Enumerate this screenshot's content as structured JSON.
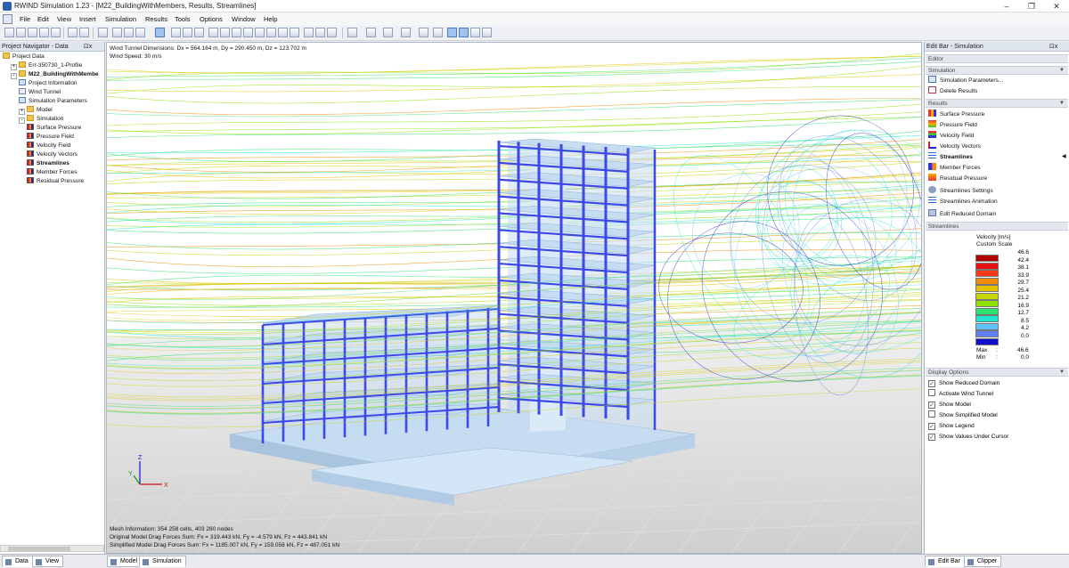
{
  "window": {
    "title": "RWIND Simulation 1.23 - [M22_BuildingWithMembers, Results, Streamlines]",
    "controls": [
      "–",
      "❐",
      "✕"
    ]
  },
  "menu": [
    "File",
    "Edit",
    "View",
    "Insert",
    "Simulation",
    "Results",
    "Tools",
    "Options",
    "Window",
    "Help"
  ],
  "navigator": {
    "title": "Project Navigator - Data",
    "pin": "⊡x",
    "items": [
      {
        "label": "Project Data",
        "icon": "folder-icon",
        "level": 0,
        "expander": "",
        "bold": false
      },
      {
        "label": "Err-350730_1-Profile",
        "icon": "folder-icon",
        "level": 1,
        "expander": "+",
        "bold": false
      },
      {
        "label": "M22_BuildingWithMembe",
        "icon": "folder-icon",
        "level": 1,
        "expander": "-",
        "bold": true
      },
      {
        "label": "Project Information",
        "icon": "document-icon",
        "level": 2,
        "expander": "",
        "bold": false
      },
      {
        "label": "Wind Tunnel",
        "icon": "wind-tunnel-icon",
        "level": 2,
        "expander": "",
        "bold": false
      },
      {
        "label": "Simulation Parameters",
        "icon": "parameters-icon",
        "level": 2,
        "expander": "",
        "bold": false
      },
      {
        "label": "Model",
        "icon": "folder-icon",
        "level": 2,
        "expander": "+",
        "bold": false
      },
      {
        "label": "Simulation",
        "icon": "folder-icon",
        "level": 2,
        "expander": "-",
        "bold": false
      },
      {
        "label": "Surface Pressure",
        "icon": "result-icon",
        "level": 3,
        "expander": "",
        "bold": false
      },
      {
        "label": "Pressure Field",
        "icon": "result-icon",
        "level": 3,
        "expander": "",
        "bold": false
      },
      {
        "label": "Velocity Field",
        "icon": "result-icon",
        "level": 3,
        "expander": "",
        "bold": false
      },
      {
        "label": "Velocity Vectors",
        "icon": "result-icon",
        "level": 3,
        "expander": "",
        "bold": false
      },
      {
        "label": "Streamlines",
        "icon": "result-icon",
        "level": 3,
        "expander": "",
        "bold": true
      },
      {
        "label": "Member Forces",
        "icon": "result-icon",
        "level": 3,
        "expander": "",
        "bold": false
      },
      {
        "label": "Residual Pressure",
        "icon": "result-icon",
        "level": 3,
        "expander": "",
        "bold": false
      }
    ],
    "tabs": [
      "Data",
      "View"
    ]
  },
  "viewport": {
    "info_top": [
      "Wind Tunnel Dimensions: Dx = 564.164 m, Dy = 290.450 m, Dz = 123.702 m",
      "Wind Speed: 30 m/s"
    ],
    "info_bottom": [
      "Mesh Information: 354 258 cells, 403 280 nodes",
      "Original Model Drag Forces Sum: Fx = 319.443 kN, Fy = -4.579 kN, Fz = 443.841 kN",
      "Simplified Model Drag Forces Sum: Fx = 1185.007 kN, Fy = 159.058 kN, Fz = 487.051 kN"
    ],
    "axes": {
      "x": "X",
      "y": "Y",
      "z": "Z"
    },
    "tabs": [
      "Model",
      "Simulation"
    ]
  },
  "editbar": {
    "title": "Edit Bar - Simulation",
    "sections": {
      "editor": "Editor",
      "simulation": "Simulation",
      "results": "Results",
      "streamlines": "Streamlines",
      "display": "Display Options"
    },
    "simulation_items": [
      "Simulation Parameters...",
      "Delete Results"
    ],
    "result_items": [
      "Surface Pressure",
      "Pressure Field",
      "Velocity Field",
      "Velocity Vectors",
      "Streamlines",
      "Member Forces",
      "Residual Pressure"
    ],
    "stream_items": [
      "Streamlines Settings",
      "Streamlines Animation",
      "Edit Reduced Domain"
    ],
    "legend": {
      "title": "Velocity [m/s]",
      "subtitle": "Custom Scale",
      "values": [
        "46.6",
        "42.4",
        "38.1",
        "33.9",
        "29.7",
        "25.4",
        "21.2",
        "16.9",
        "12.7",
        "8.5",
        "4.2",
        "0.0"
      ],
      "colors": [
        "#b00000",
        "#e61010",
        "#ff3a1a",
        "#f08a00",
        "#e6c200",
        "#c8d600",
        "#90e000",
        "#30e070",
        "#20e8d0",
        "#60c0f8",
        "#6080f0",
        "#1010c8"
      ],
      "max_label": "Max",
      "max_value": "46.6",
      "min_label": "Min",
      "min_value": "0.0",
      "sep": ":"
    },
    "display_options": [
      {
        "label": "Show Reduced Domain",
        "checked": true
      },
      {
        "label": "Activate Wind Tunnel",
        "checked": false
      },
      {
        "label": "Show Model",
        "checked": true
      },
      {
        "label": "Show Simplified Model",
        "checked": false
      },
      {
        "label": "Show Legend",
        "checked": true
      },
      {
        "label": "Show Values Under Cursor",
        "checked": true
      }
    ],
    "tabs": [
      "Edit Bar",
      "Clipper"
    ]
  },
  "colors": {
    "member": "#3d48e8",
    "slab": "#c6dcf0",
    "ground": "#d4d4d4"
  }
}
